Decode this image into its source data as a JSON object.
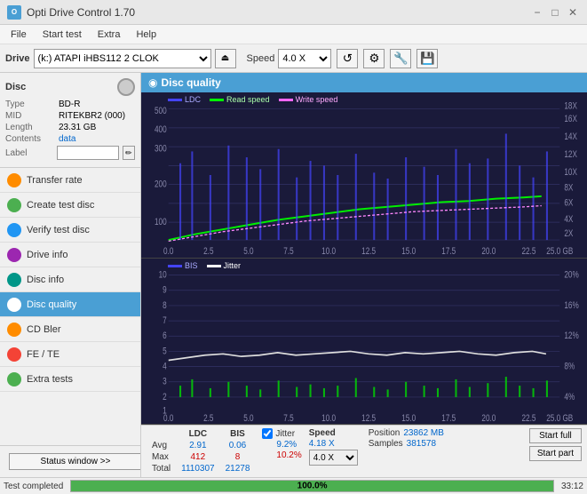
{
  "titlebar": {
    "title": "Opti Drive Control 1.70",
    "min": "−",
    "max": "□",
    "close": "✕"
  },
  "menu": {
    "items": [
      "File",
      "Start test",
      "Extra",
      "Help"
    ]
  },
  "toolbar": {
    "drive_label": "Drive",
    "drive_value": "(k:) ATAPI iHBS112  2 CLOK",
    "speed_label": "Speed",
    "speed_value": "4.0 X"
  },
  "disc": {
    "title": "Disc",
    "type_label": "Type",
    "type_value": "BD-R",
    "mid_label": "MID",
    "mid_value": "RITEKBR2 (000)",
    "length_label": "Length",
    "length_value": "23.31 GB",
    "contents_label": "Contents",
    "contents_value": "data",
    "label_label": "Label",
    "label_value": ""
  },
  "nav": {
    "items": [
      {
        "id": "transfer-rate",
        "label": "Transfer rate",
        "icon": "orange"
      },
      {
        "id": "create-test-disc",
        "label": "Create test disc",
        "icon": "green"
      },
      {
        "id": "verify-test-disc",
        "label": "Verify test disc",
        "icon": "blue"
      },
      {
        "id": "drive-info",
        "label": "Drive info",
        "icon": "purple"
      },
      {
        "id": "disc-info",
        "label": "Disc info",
        "icon": "teal"
      },
      {
        "id": "disc-quality",
        "label": "Disc quality",
        "icon": "blue",
        "active": true
      },
      {
        "id": "cd-bler",
        "label": "CD Bler",
        "icon": "orange"
      },
      {
        "id": "fe-te",
        "label": "FE / TE",
        "icon": "red"
      },
      {
        "id": "extra-tests",
        "label": "Extra tests",
        "icon": "green"
      }
    ],
    "status_btn": "Status window >>"
  },
  "chart": {
    "title": "Disc quality",
    "legend1": {
      "ldc": "LDC",
      "read": "Read speed",
      "write": "Write speed"
    },
    "legend2": {
      "bis": "BIS",
      "jitter": "Jitter"
    },
    "top_ymax": 500,
    "top_ylabel": "18X",
    "top_xmax": 25,
    "bot_ymax": 10,
    "bot_xmax": 25
  },
  "stats": {
    "headers": [
      "LDC",
      "BIS",
      "",
      "Jitter",
      "Speed",
      ""
    ],
    "avg_label": "Avg",
    "avg_ldc": "2.91",
    "avg_bis": "0.06",
    "avg_jitter": "9.2%",
    "avg_speed": "4.18 X",
    "avg_speed2": "4.0 X",
    "max_label": "Max",
    "max_ldc": "412",
    "max_bis": "8",
    "max_jitter": "10.2%",
    "pos_label": "Position",
    "pos_value": "23862 MB",
    "total_label": "Total",
    "total_ldc": "1110307",
    "total_bis": "21278",
    "samples_label": "Samples",
    "samples_value": "381578",
    "jitter_checked": true,
    "start_full": "Start full",
    "start_part": "Start part"
  },
  "statusbar": {
    "message": "Test completed",
    "progress": 100,
    "progress_text": "100.0%",
    "time": "33:12"
  }
}
